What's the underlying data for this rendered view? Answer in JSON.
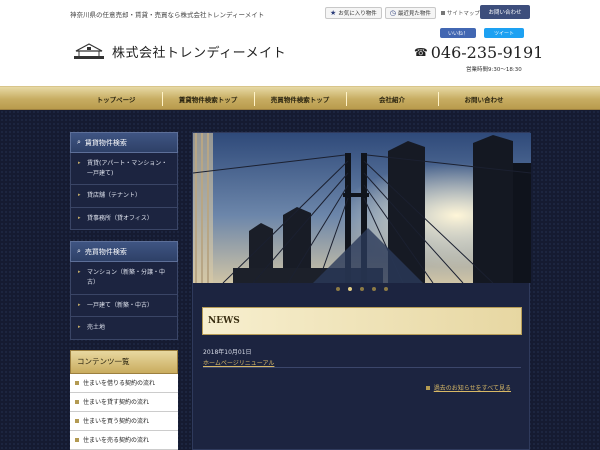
{
  "header": {
    "tagline": "神奈川県の任意売却・賃貸・売買なら株式会社トレンディーメイト",
    "favorites": "お気に入り物件",
    "recently_viewed": "最近見た物件",
    "sitemap": "サイトマップ",
    "contact": "お問い合わせ",
    "company_name": "株式会社トレンディーメイト",
    "like": "いいね！",
    "tweet": "ツイート",
    "phone": "046-235-9191",
    "hours": "営業時間9:30～18:30"
  },
  "nav": [
    {
      "label": "トップページ"
    },
    {
      "label": "賃貸物件検索トップ"
    },
    {
      "label": "売買物件検索トップ"
    },
    {
      "label": "会社紹介"
    },
    {
      "label": "お問い合わせ"
    }
  ],
  "sidebar": {
    "rental": {
      "title": "賃貸物件検索",
      "items": [
        "賃貸(アパート・マンション・一戸建て)",
        "貸店舗（テナント）",
        "貸事務所（貸オフィス）"
      ]
    },
    "sale": {
      "title": "売買物件検索",
      "items": [
        "マンション（新築・分譲・中古）",
        "一戸建て（新築・中古）",
        "売土地"
      ]
    },
    "contents": {
      "title": "コンテンツ一覧",
      "items": [
        "住まいを借りる契約の流れ",
        "住まいを貸す契約の流れ",
        "住まいを買う契約の流れ",
        "住まいを売る契約の流れ"
      ]
    }
  },
  "slider": {
    "count": 5,
    "active": 1
  },
  "news": {
    "title": "NEWS",
    "date": "2018年10月01日",
    "link": "ホームページリニューアル",
    "all": "過去のお知らせをすべて見る"
  },
  "colors": {
    "gold": "#c9ac5e",
    "navy": "#151b31",
    "blue": "#3f5583"
  }
}
